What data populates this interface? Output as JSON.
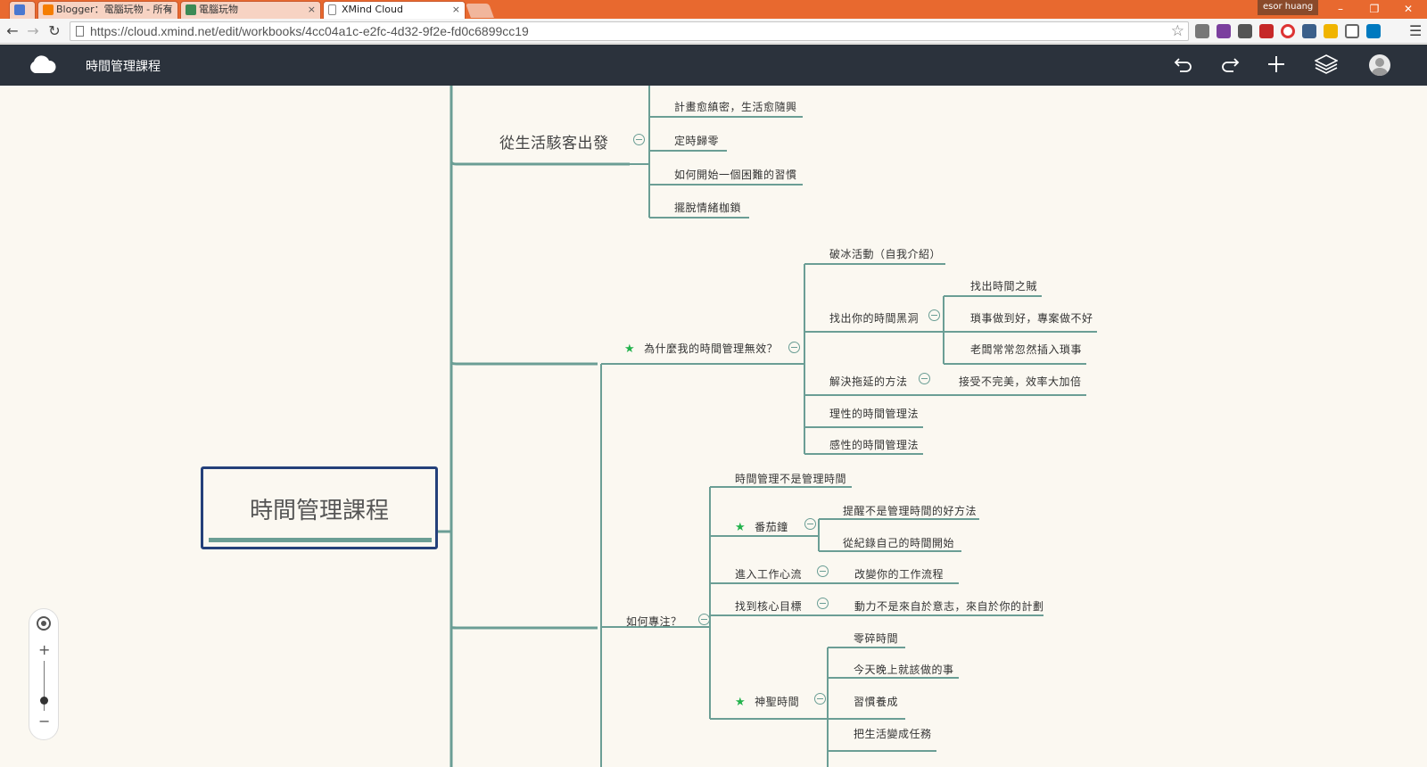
{
  "browser": {
    "tabs": [
      {
        "label": ""
      },
      {
        "label": "Blogger：電腦玩物 - 所有"
      },
      {
        "label": "電腦玩物"
      },
      {
        "label": "XMind Cloud"
      }
    ],
    "user": "esor huang",
    "url": "https://cloud.xmind.net/edit/workbooks/4cc04a1c-e2fc-4d32-9f2e-fd0c6899cc19"
  },
  "app": {
    "doc_title": "時間管理課程"
  },
  "mindmap": {
    "central": "時間管理課程",
    "b1": {
      "title": "從生活駭客出發",
      "children": [
        "計畫愈縝密，生活愈隨興",
        "定時歸零",
        "如何開始一個困難的習慣",
        "擺脫情緒枷鎖"
      ]
    },
    "b2": {
      "title": "為什麼我的時間管理無效？",
      "c1": "破冰活動（自我介紹）",
      "c2": "找出你的時間黑洞",
      "c2_children": [
        "找出時間之賊",
        "瑣事做到好，專案做不好",
        "老闆常常忽然插入瑣事"
      ],
      "c3": "解決拖延的方法",
      "c3_child": "接受不完美，效率大加倍",
      "c4": "理性的時間管理法",
      "c5": "感性的時間管理法"
    },
    "b3": {
      "title": "如何專注？",
      "c1": "時間管理不是管理時間",
      "c2": "番茄鐘",
      "c2_children": [
        "提醒不是管理時間的好方法",
        "從紀錄自己的時間開始"
      ],
      "c3": "進入工作心流",
      "c3_child": "改變你的工作流程",
      "c4": "找到核心目標",
      "c4_child": "動力不是來自於意志，來自於你的計劃",
      "c5": "神聖時間",
      "c5_children": [
        "零碎時間",
        "今天晚上就該做的事",
        "習慣養成",
        "把生活變成任務"
      ]
    }
  },
  "zoom": {
    "plus": "+",
    "minus": "−",
    "level": 0.75
  }
}
